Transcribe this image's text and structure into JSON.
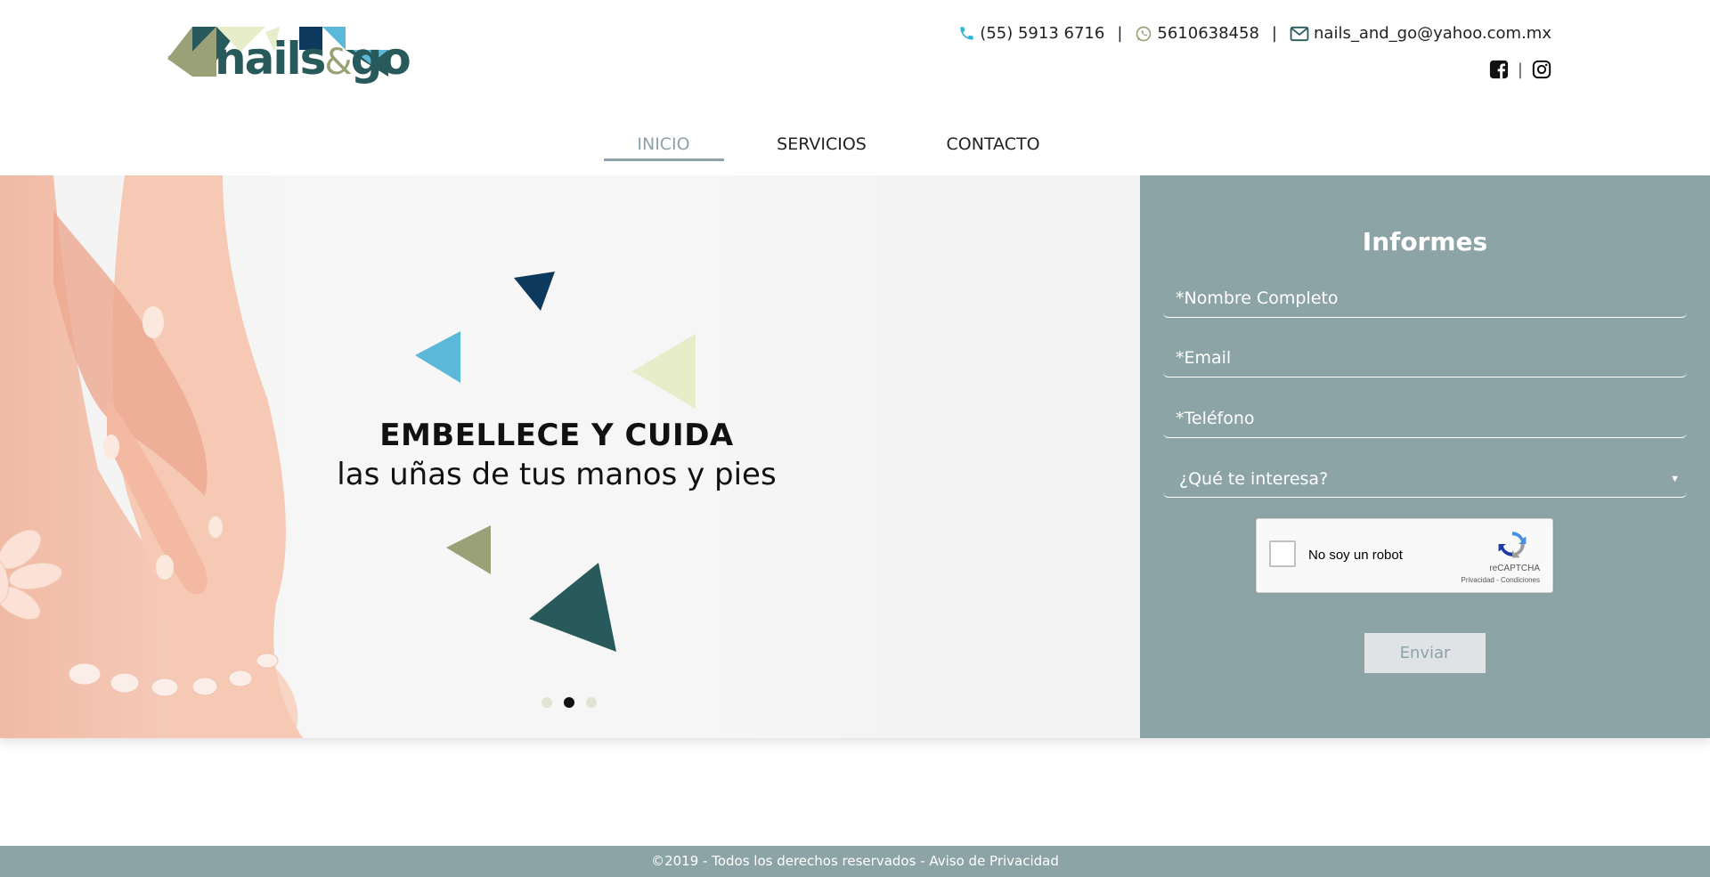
{
  "brand": {
    "logo_text": "nails",
    "logo_amp": "&",
    "logo_text2": "go"
  },
  "contact": {
    "phone": "(55) 5913 6716",
    "whatsapp": "5610638458",
    "email": "nails_and_go@yahoo.com.mx",
    "separator": "|"
  },
  "social": {
    "separator": "|",
    "icons": [
      "facebook-icon",
      "instagram-icon"
    ]
  },
  "nav": {
    "items": [
      {
        "label": "INICIO",
        "active": true
      },
      {
        "label": "SERVICIOS",
        "active": false
      },
      {
        "label": "CONTACTO",
        "active": false
      }
    ]
  },
  "hero": {
    "headline_bold": "EMBELLECE Y CUIDA",
    "headline_sub": "las uñas de tus manos y pies",
    "slides_count": 3,
    "active_slide": 2
  },
  "form": {
    "title": "Informes",
    "name_placeholder": "*Nombre Completo",
    "email_placeholder": "*Email",
    "phone_placeholder": "*Teléfono",
    "interest_select": "¿Qué te interesa?",
    "captcha_label": "No soy un robot",
    "captcha_brand": "reCAPTCHA",
    "captcha_terms": "Privacidad - Condiciones",
    "submit_label": "Enviar"
  },
  "footer": {
    "text": "©2019 - Todos los derechos reservados - Aviso de Privacidad"
  },
  "colors": {
    "accent": "#8da4a6",
    "nav_active": "#8ea2a8",
    "phone_icon": "#29b6d8",
    "whatsapp_icon": "#9aa177",
    "email_icon": "#285a5c"
  }
}
